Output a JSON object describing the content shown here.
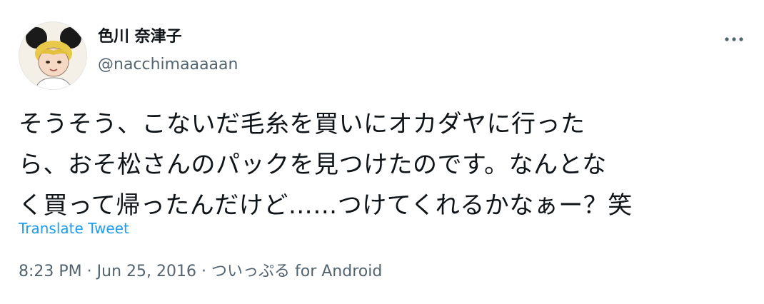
{
  "author": {
    "display_name": "色川 奈津子",
    "handle": "@nacchimaaaaan"
  },
  "more_menu_icon": "more-horizontal-icon",
  "tweet": {
    "lines": [
      "そうそう、こないだ毛糸を買いにオカダヤに行った",
      "ら、おそ松さんのパックを見つけたのです。なんとな",
      "く買って帰ったんだけど……つけてくれるかなぁー？笑"
    ]
  },
  "translate_label": "Translate Tweet",
  "meta": {
    "time": "8:23 PM",
    "separator": "·",
    "date": "Jun 25, 2016",
    "source": "ついっぷる for Android"
  },
  "colors": {
    "text": "#0f1419",
    "secondary": "#536471",
    "link": "#1d9bf0"
  }
}
